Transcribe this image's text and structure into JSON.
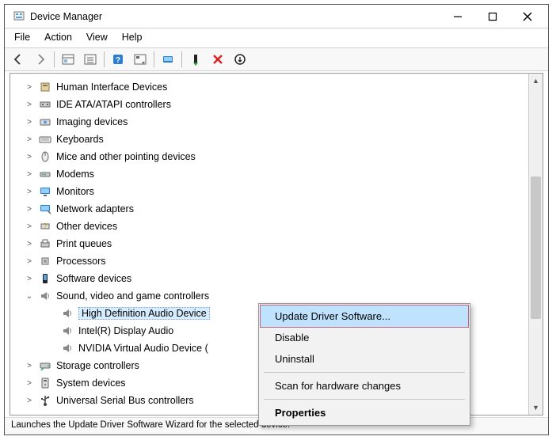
{
  "window": {
    "title": "Device Manager"
  },
  "menubar": {
    "items": [
      "File",
      "Action",
      "View",
      "Help"
    ]
  },
  "tree": {
    "nodes": [
      {
        "label": "Human Interface Devices",
        "icon": "hid",
        "expanded": false
      },
      {
        "label": "IDE ATA/ATAPI controllers",
        "icon": "ide",
        "expanded": false
      },
      {
        "label": "Imaging devices",
        "icon": "imaging",
        "expanded": false
      },
      {
        "label": "Keyboards",
        "icon": "keyboard",
        "expanded": false
      },
      {
        "label": "Mice and other pointing devices",
        "icon": "mouse",
        "expanded": false
      },
      {
        "label": "Modems",
        "icon": "modem",
        "expanded": false
      },
      {
        "label": "Monitors",
        "icon": "monitor",
        "expanded": false
      },
      {
        "label": "Network adapters",
        "icon": "network",
        "expanded": false
      },
      {
        "label": "Other devices",
        "icon": "other",
        "expanded": false
      },
      {
        "label": "Print queues",
        "icon": "printer",
        "expanded": false
      },
      {
        "label": "Processors",
        "icon": "cpu",
        "expanded": false
      },
      {
        "label": "Software devices",
        "icon": "software",
        "expanded": false
      },
      {
        "label": "Sound, video and game controllers",
        "icon": "sound",
        "expanded": true,
        "children": [
          {
            "label": "High Definition Audio Device",
            "icon": "speaker",
            "selected": true
          },
          {
            "label": "Intel(R) Display Audio",
            "icon": "speaker",
            "selected": false
          },
          {
            "label": "NVIDIA Virtual Audio Device (",
            "icon": "speaker",
            "selected": false
          }
        ]
      },
      {
        "label": "Storage controllers",
        "icon": "storage",
        "expanded": false
      },
      {
        "label": "System devices",
        "icon": "system",
        "expanded": false
      },
      {
        "label": "Universal Serial Bus controllers",
        "icon": "usb",
        "expanded": false
      }
    ]
  },
  "context_menu": {
    "items": [
      {
        "label": "Update Driver Software...",
        "highlight": true
      },
      {
        "label": "Disable",
        "highlight": false
      },
      {
        "label": "Uninstall",
        "highlight": false
      },
      {
        "sep": true
      },
      {
        "label": "Scan for hardware changes",
        "highlight": false
      },
      {
        "sep": true
      },
      {
        "label": "Properties",
        "highlight": false,
        "bold": true
      }
    ]
  },
  "statusbar": {
    "text": "Launches the Update Driver Software Wizard for the selected device."
  }
}
